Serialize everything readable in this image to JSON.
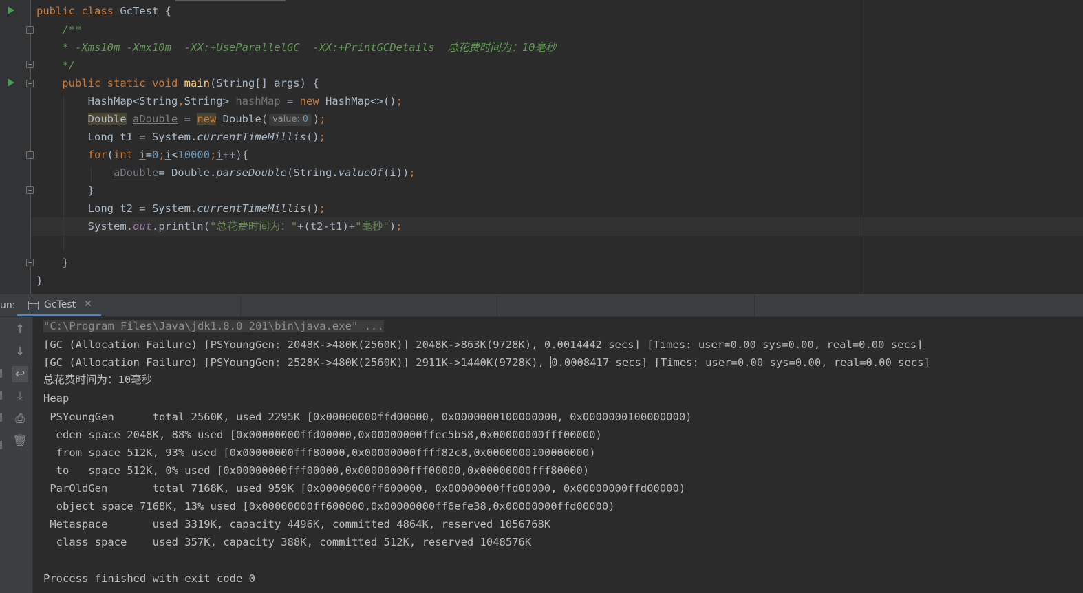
{
  "editor": {
    "file_class": "GcTest",
    "comment": {
      "open": "/**",
      "body": " * -Xms10m -Xmx10m  -XX:+UseParallelGC  -XX:+PrintGCDetails  总花费时间为：10毫秒",
      "close": " */"
    },
    "param_hint": {
      "name": "value:",
      "value": "0"
    },
    "string_prefix": "\"总花费时间为：\"",
    "string_suffix": "\"毫秒\"",
    "loop_limit": "10000"
  },
  "run_panel": {
    "label": "un:",
    "tab_title": "GcTest",
    "tab_close": "✕",
    "toolbar": {
      "up": "up-arrow-icon",
      "down": "down-arrow-icon",
      "wrap": "soft-wrap-icon",
      "scroll_end": "scroll-to-end-icon",
      "print": "print-icon",
      "clear": "trash-icon"
    }
  },
  "console": {
    "command": "\"C:\\Program Files\\Java\\jdk1.8.0_201\\bin\\java.exe\" ...",
    "gc1": "[GC (Allocation Failure) [PSYoungGen: 2048K->480K(2560K)] 2048K->863K(9728K), 0.0014442 secs] [Times: user=0.00 sys=0.00, real=0.00 secs] ",
    "gc2_a": "[GC (Allocation Failure) [PSYoungGen: 2528K->480K(2560K)] 2911K->1440K(9728K), ",
    "gc2_b": "0.0008417 secs] [Times: user=0.00 sys=0.00, real=0.00 secs] ",
    "total_time": "总花费时间为：10毫秒",
    "heap": "Heap",
    "psyounggen": " PSYoungGen      total 2560K, used 2295K [0x00000000ffd00000, 0x0000000100000000, 0x0000000100000000)",
    "eden": "  eden space 2048K, 88% used [0x00000000ffd00000,0x00000000ffec5b58,0x00000000fff00000)",
    "from": "  from space 512K, 93% used [0x00000000fff80000,0x00000000ffff82c8,0x0000000100000000)",
    "to": "  to   space 512K, 0% used [0x00000000fff00000,0x00000000fff00000,0x00000000fff80000)",
    "paroldgen": " ParOldGen       total 7168K, used 959K [0x00000000ff600000, 0x00000000ffd00000, 0x00000000ffd00000)",
    "object": "  object space 7168K, 13% used [0x00000000ff600000,0x00000000ff6efe38,0x00000000ffd00000)",
    "metaspace": " Metaspace       used 3319K, capacity 4496K, committed 4864K, reserved 1056768K",
    "classspace": "  class space    used 357K, capacity 388K, committed 512K, reserved 1048576K",
    "exit": "Process finished with exit code 0"
  },
  "colors": {
    "background": "#2b2b2b",
    "keyword": "#cc7832",
    "comment": "#629755",
    "string": "#6a8759",
    "number": "#6897bb",
    "method": "#ffc66d",
    "tab_accent": "#4a88c7",
    "run_icon": "#499c54"
  }
}
